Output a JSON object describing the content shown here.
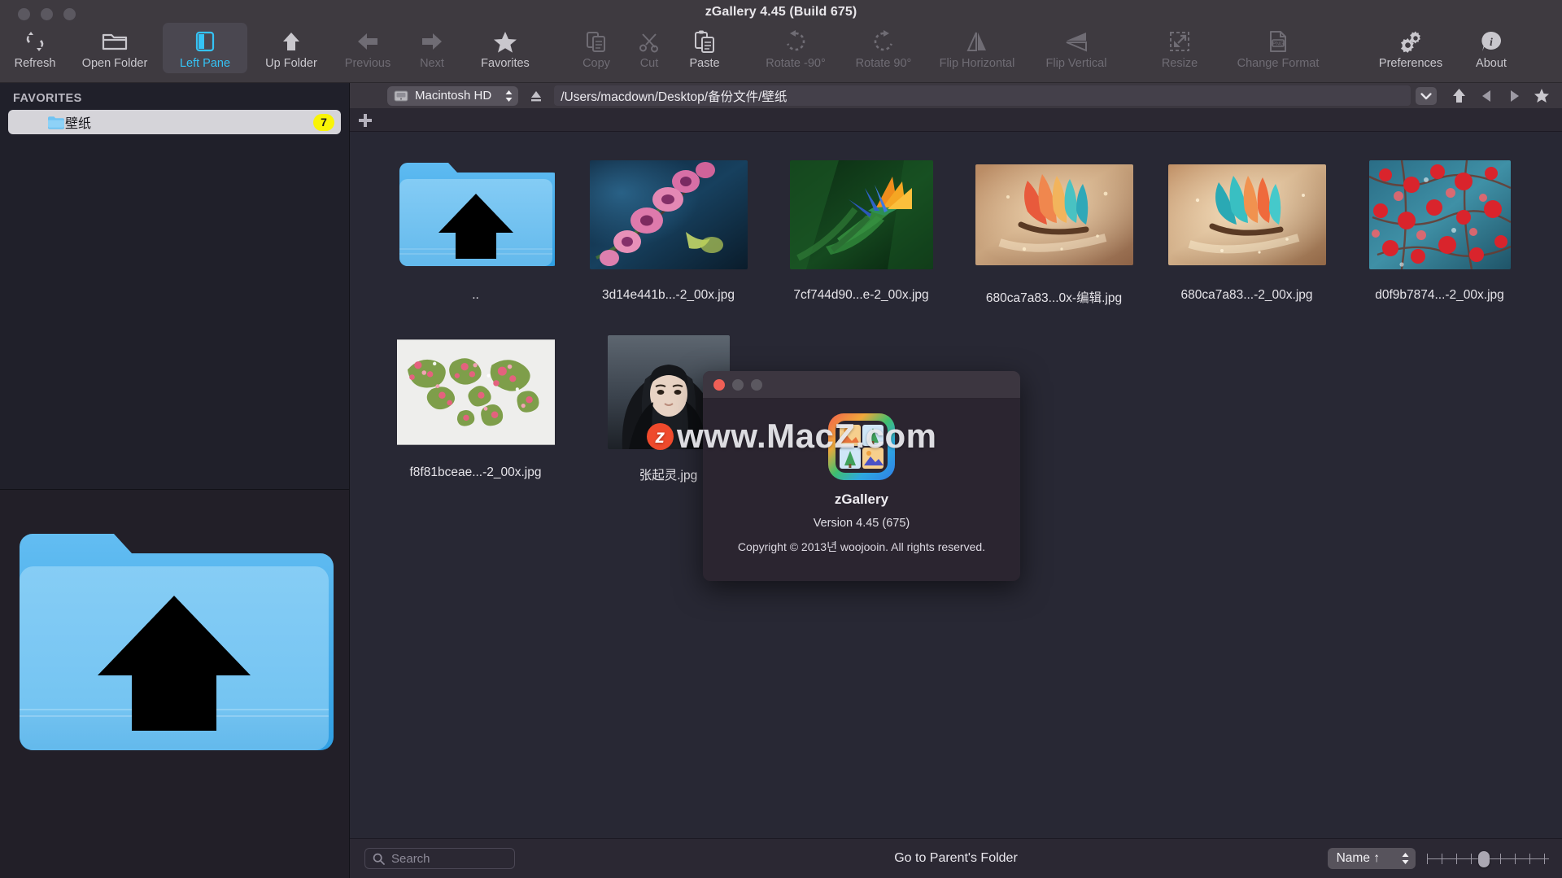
{
  "window": {
    "title": "zGallery 4.45 (Build 675)"
  },
  "toolbar": {
    "items": [
      {
        "label": "Refresh",
        "icon": "refresh-icon",
        "state": "normal"
      },
      {
        "label": "Open Folder",
        "icon": "open-folder-icon",
        "state": "normal"
      },
      {
        "label": "Left Pane",
        "icon": "left-pane-icon",
        "state": "active"
      },
      {
        "label": "Up Folder",
        "icon": "up-folder-icon",
        "state": "normal"
      },
      {
        "label": "Previous",
        "icon": "arrow-left-icon",
        "state": "disabled"
      },
      {
        "label": "Next",
        "icon": "arrow-right-icon",
        "state": "disabled"
      },
      {
        "label": "Favorites",
        "icon": "star-icon",
        "state": "normal"
      },
      {
        "label": "Copy",
        "icon": "copy-icon",
        "state": "disabled"
      },
      {
        "label": "Cut",
        "icon": "scissors-icon",
        "state": "disabled"
      },
      {
        "label": "Paste",
        "icon": "paste-icon",
        "state": "normal"
      },
      {
        "label": "Rotate -90°",
        "icon": "rotate-ccw-icon",
        "state": "disabled"
      },
      {
        "label": "Rotate 90°",
        "icon": "rotate-cw-icon",
        "state": "disabled"
      },
      {
        "label": "Flip Horizontal",
        "icon": "flip-horizontal-icon",
        "state": "disabled"
      },
      {
        "label": "Flip Vertical",
        "icon": "flip-vertical-icon",
        "state": "disabled"
      },
      {
        "label": "Resize",
        "icon": "resize-icon",
        "state": "disabled"
      },
      {
        "label": "Change Format",
        "icon": "change-format-icon",
        "state": "disabled"
      },
      {
        "label": "Preferences",
        "icon": "gear-icon",
        "state": "normal"
      },
      {
        "label": "About",
        "icon": "info-icon",
        "state": "normal"
      }
    ]
  },
  "sidebar": {
    "section_title": "FAVORITES",
    "items": [
      {
        "label": "壁纸",
        "badge": "7",
        "icon": "folder-icon"
      }
    ]
  },
  "pathbar": {
    "volume": "Macintosh HD",
    "path": "/Users/macdown/Desktop/备份文件/壁纸"
  },
  "grid": {
    "items": [
      {
        "caption": "..",
        "kind": "parent-folder"
      },
      {
        "caption": "3d14e441b...-2_00x.jpg",
        "kind": "image",
        "thumb": "orchid"
      },
      {
        "caption": "7cf744d90...e-2_00x.jpg",
        "kind": "image",
        "thumb": "bird-of-paradise"
      },
      {
        "caption": "680ca7a83...0x-编辑.jpg",
        "kind": "image",
        "thumb": "feathers-warm"
      },
      {
        "caption": "680ca7a83...-2_00x.jpg",
        "kind": "image",
        "thumb": "feathers-cool"
      },
      {
        "caption": "d0f9b7874...-2_00x.jpg",
        "kind": "image",
        "thumb": "red-blossom"
      },
      {
        "caption": "f8f81bceae...-2_00x.jpg",
        "kind": "image",
        "thumb": "flower-map"
      },
      {
        "caption": "张起灵.jpg",
        "kind": "image",
        "thumb": "hooded-portrait"
      }
    ]
  },
  "statusbar": {
    "search_placeholder": "Search",
    "status_text": "Go to Parent's Folder",
    "sort_label": "Name ↑"
  },
  "about_dialog": {
    "app_name": "zGallery",
    "version": "Version 4.45 (675)",
    "copyright": "Copyright © 2013년 woojooin. All rights reserved."
  },
  "watermark": {
    "badge": "z",
    "text": "www.MacZ.com"
  },
  "colors": {
    "accent": "#35c3f5",
    "badge": "#f9f406",
    "toolbar_bg": "#3e3a40",
    "sidebar_bg": "#20202a",
    "content_bg": "#282834"
  }
}
